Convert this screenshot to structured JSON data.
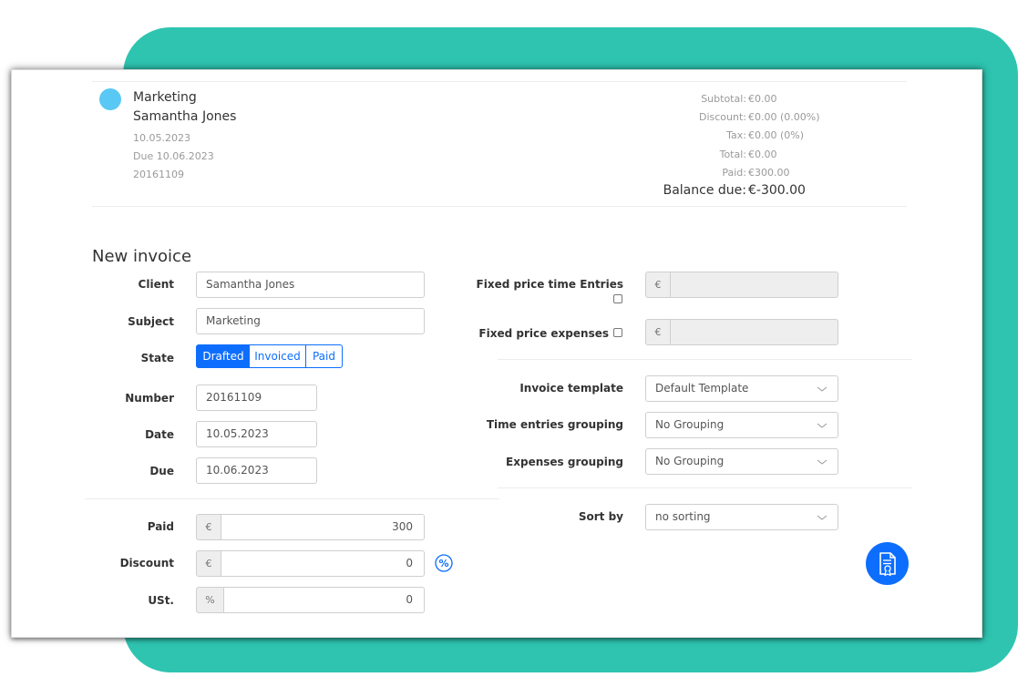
{
  "invoice_summary": {
    "subject": "Marketing",
    "client": "Samantha Jones",
    "date": "10.05.2023",
    "due": "Due 10.06.2023",
    "number": "20161109",
    "subtotal_label": "Subtotal:",
    "subtotal_value": "€0.00",
    "discount_label": "Discount:",
    "discount_value": "€0.00 (0.00%)",
    "tax_label": "Tax:",
    "tax_value": "€0.00 (0%)",
    "total_label": "Total:",
    "total_value": "€0.00",
    "paid_label": "Paid:",
    "paid_value": "€300.00",
    "balance_label": "Balance due:",
    "balance_value": "€-300.00",
    "dot_color": "#5ac8f5"
  },
  "form": {
    "title": "New invoice",
    "client_label": "Client",
    "client_value": "Samantha Jones",
    "subject_label": "Subject",
    "subject_value": "Marketing",
    "state_label": "State",
    "state_options": [
      "Drafted",
      "Invoiced",
      "Paid"
    ],
    "state_selected": "Drafted",
    "number_label": "Number",
    "number_value": "20161109",
    "date_label": "Date",
    "date_value": "10.05.2023",
    "due_label": "Due",
    "due_value": "10.06.2023",
    "paid_label": "Paid",
    "paid_currency": "€",
    "paid_value": "300",
    "discount_label": "Discount",
    "discount_currency": "€",
    "discount_value": "0",
    "discount_toggle_icon": "percent-icon",
    "ust_label": "USt.",
    "ust_unit": "%",
    "ust_value": "0",
    "fixed_time_label": "Fixed price time Entries",
    "fixed_time_currency": "€",
    "fixed_expenses_label": "Fixed price expenses",
    "fixed_expenses_currency": "€",
    "template_label": "Invoice template",
    "template_value": "Default Template",
    "time_grouping_label": "Time entries grouping",
    "time_grouping_value": "No Grouping",
    "expenses_grouping_label": "Expenses grouping",
    "expenses_grouping_value": "No Grouping",
    "sort_label": "Sort by",
    "sort_value": "no sorting",
    "create_icon": "invoice-certificate-icon"
  },
  "colors": {
    "accent": "#0d6efd",
    "teal_background": "#2ec4b0"
  }
}
